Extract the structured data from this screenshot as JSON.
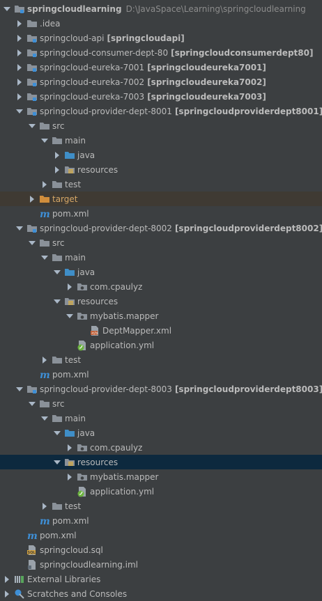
{
  "tree": [
    {
      "label": "springcloudlearning",
      "path": "D:\\JavaSpace\\Learning\\springcloudlearning",
      "bold": true,
      "icon": "project-module-icon",
      "depth": 0,
      "arrow": "down"
    },
    {
      "label": ".idea",
      "icon": "folder-icon",
      "depth": 1,
      "arrow": "right"
    },
    {
      "label": "springcloud-api",
      "module": "[springcloudapi]",
      "icon": "module-folder-icon",
      "depth": 1,
      "arrow": "right"
    },
    {
      "label": "springcloud-consumer-dept-80",
      "module": "[springcloudconsumerdept80]",
      "icon": "module-folder-icon",
      "depth": 1,
      "arrow": "right"
    },
    {
      "label": "springcloud-eureka-7001",
      "module": "[springcloudeureka7001]",
      "icon": "module-folder-icon",
      "depth": 1,
      "arrow": "right"
    },
    {
      "label": "springcloud-eureka-7002",
      "module": "[springcloudeureka7002]",
      "icon": "module-folder-icon",
      "depth": 1,
      "arrow": "right"
    },
    {
      "label": "springcloud-eureka-7003",
      "module": "[springcloudeureka7003]",
      "icon": "module-folder-icon",
      "depth": 1,
      "arrow": "right"
    },
    {
      "label": "springcloud-provider-dept-8001",
      "module": "[springcloudproviderdept8001]",
      "icon": "module-folder-icon",
      "depth": 1,
      "arrow": "down"
    },
    {
      "label": "src",
      "icon": "folder-icon",
      "depth": 2,
      "arrow": "down"
    },
    {
      "label": "main",
      "icon": "folder-icon",
      "depth": 3,
      "arrow": "down"
    },
    {
      "label": "java",
      "icon": "source-folder-icon",
      "depth": 4,
      "arrow": "right"
    },
    {
      "label": "resources",
      "icon": "resources-folder-icon",
      "depth": 4,
      "arrow": "right"
    },
    {
      "label": "test",
      "icon": "folder-icon",
      "depth": 3,
      "arrow": "right"
    },
    {
      "label": "target",
      "icon": "excluded-folder-icon",
      "depth": 2,
      "arrow": "right",
      "state": "excluded",
      "orange": true
    },
    {
      "label": "pom.xml",
      "icon": "maven-icon",
      "depth": 2
    },
    {
      "label": "springcloud-provider-dept-8002",
      "module": "[springcloudproviderdept8002]",
      "icon": "module-folder-icon",
      "depth": 1,
      "arrow": "down"
    },
    {
      "label": "src",
      "icon": "folder-icon",
      "depth": 2,
      "arrow": "down"
    },
    {
      "label": "main",
      "icon": "folder-icon",
      "depth": 3,
      "arrow": "down"
    },
    {
      "label": "java",
      "icon": "source-folder-icon",
      "depth": 4,
      "arrow": "down"
    },
    {
      "label": "com.cpaulyz",
      "icon": "package-icon",
      "depth": 5,
      "arrow": "right"
    },
    {
      "label": "resources",
      "icon": "resources-folder-icon",
      "depth": 4,
      "arrow": "down"
    },
    {
      "label": "mybatis.mapper",
      "icon": "package-icon",
      "depth": 5,
      "arrow": "down"
    },
    {
      "label": "DeptMapper.xml",
      "icon": "xml-file-icon",
      "depth": 6
    },
    {
      "label": "application.yml",
      "icon": "spring-yml-icon",
      "depth": 5
    },
    {
      "label": "test",
      "icon": "folder-icon",
      "depth": 3,
      "arrow": "right"
    },
    {
      "label": "pom.xml",
      "icon": "maven-icon",
      "depth": 2
    },
    {
      "label": "springcloud-provider-dept-8003",
      "module": "[springcloudproviderdept8003]",
      "icon": "module-folder-icon",
      "depth": 1,
      "arrow": "down"
    },
    {
      "label": "src",
      "icon": "folder-icon",
      "depth": 2,
      "arrow": "down"
    },
    {
      "label": "main",
      "icon": "folder-icon",
      "depth": 3,
      "arrow": "down"
    },
    {
      "label": "java",
      "icon": "source-folder-icon",
      "depth": 4,
      "arrow": "down"
    },
    {
      "label": "com.cpaulyz",
      "icon": "package-icon",
      "depth": 5,
      "arrow": "right"
    },
    {
      "label": "resources",
      "icon": "resources-folder-icon",
      "depth": 4,
      "arrow": "down",
      "state": "selected"
    },
    {
      "label": "mybatis.mapper",
      "icon": "package-icon",
      "depth": 5,
      "arrow": "right"
    },
    {
      "label": "application.yml",
      "icon": "spring-yml-icon",
      "depth": 5
    },
    {
      "label": "test",
      "icon": "folder-icon",
      "depth": 3,
      "arrow": "right"
    },
    {
      "label": "pom.xml",
      "icon": "maven-icon",
      "depth": 2
    },
    {
      "label": "pom.xml",
      "icon": "maven-icon",
      "depth": 1
    },
    {
      "label": "springcloud.sql",
      "icon": "sql-file-icon",
      "depth": 1
    },
    {
      "label": "springcloudlearning.iml",
      "icon": "iml-file-icon",
      "depth": 1
    },
    {
      "label": "External Libraries",
      "icon": "libraries-icon",
      "depth": 0,
      "arrow": "right"
    },
    {
      "label": "Scratches and Consoles",
      "icon": "scratches-icon",
      "depth": 0,
      "arrow": "right"
    }
  ]
}
